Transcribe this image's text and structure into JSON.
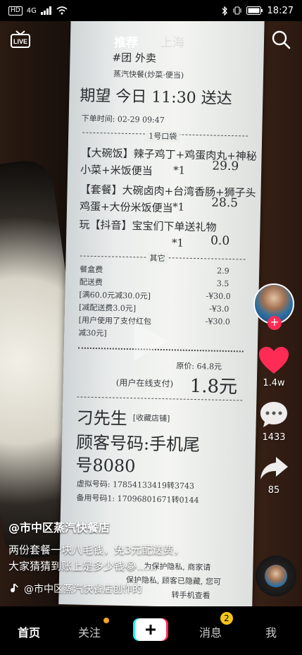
{
  "status_bar": {
    "hd": "HD",
    "network": "4G",
    "time": "18:27"
  },
  "top_nav": {
    "tab_recommend": "推荐",
    "tab_city": "上海"
  },
  "receipt": {
    "store": "#团 外卖",
    "store_sub": "蒸汽快餐(炒菜·便当)",
    "eta": "期望 今日 11:30 送达",
    "order_time": "下单时间: 02-29 09:47",
    "bag": "1号口袋",
    "items": [
      {
        "name": "【大碗饭】辣子鸡丁+鸡蛋肉丸+神秘",
        "name2": "小菜+米饭便当",
        "qty": "*1",
        "price": "29.9"
      },
      {
        "name": "【套餐】大碗卤肉+台湾香肠+狮子头",
        "name2": "鸡蛋+大份米饭便当",
        "qty": "*1",
        "price": "28.5"
      },
      {
        "name": "玩【抖音】宝宝们下单送礼物",
        "name2": "",
        "qty": "*1",
        "price": "0.0"
      }
    ],
    "other": "其它",
    "fees": [
      {
        "label": "餐盒费",
        "value": "2.9"
      },
      {
        "label": "配送费",
        "value": "3.5"
      },
      {
        "label": "[满60.0元减30.0元]",
        "value": "-¥30.0"
      },
      {
        "label": "[减配送费3.0元]",
        "value": "-¥3.0"
      },
      {
        "label": "[用户使用了支付红包",
        "value": "-¥30.0"
      },
      {
        "label": "减30元]",
        "value": ""
      }
    ],
    "original": "原价: 64.8元",
    "paid_label": "(用户在线支付)",
    "paid": "1.8元",
    "customer": "刁先生",
    "customer_tag": "[收藏店铺]",
    "number_label": "顾客号码:手机尾",
    "number_tail": "号8080",
    "virtual": "虚拟号码: 17854133419转3743",
    "backup": "备用号码1: 17096801671转0144",
    "privacy1": "为保护隐私, 商家请",
    "privacy2": "保护隐私, 顾客已隐藏, 您可",
    "privacy3": "转手机查看"
  },
  "sidebar": {
    "like_count": "1.4w",
    "comment_count": "1433",
    "share_count": "85"
  },
  "caption": {
    "author": "@市中区蒸汽快餐店",
    "line1": "两份套餐一块八毛钱，免3元配送费，",
    "line2": "大家猜猜到账上是多少钱😂......",
    "music": "@市中区蒸汽快餐店创作的"
  },
  "tabbar": {
    "home": "首页",
    "follow": "关注",
    "messages": "消息",
    "messages_badge": "2",
    "me": "我"
  },
  "colors": {
    "accent": "#fe2c55",
    "like": "#fe2c55",
    "badge": "#f5c518"
  }
}
